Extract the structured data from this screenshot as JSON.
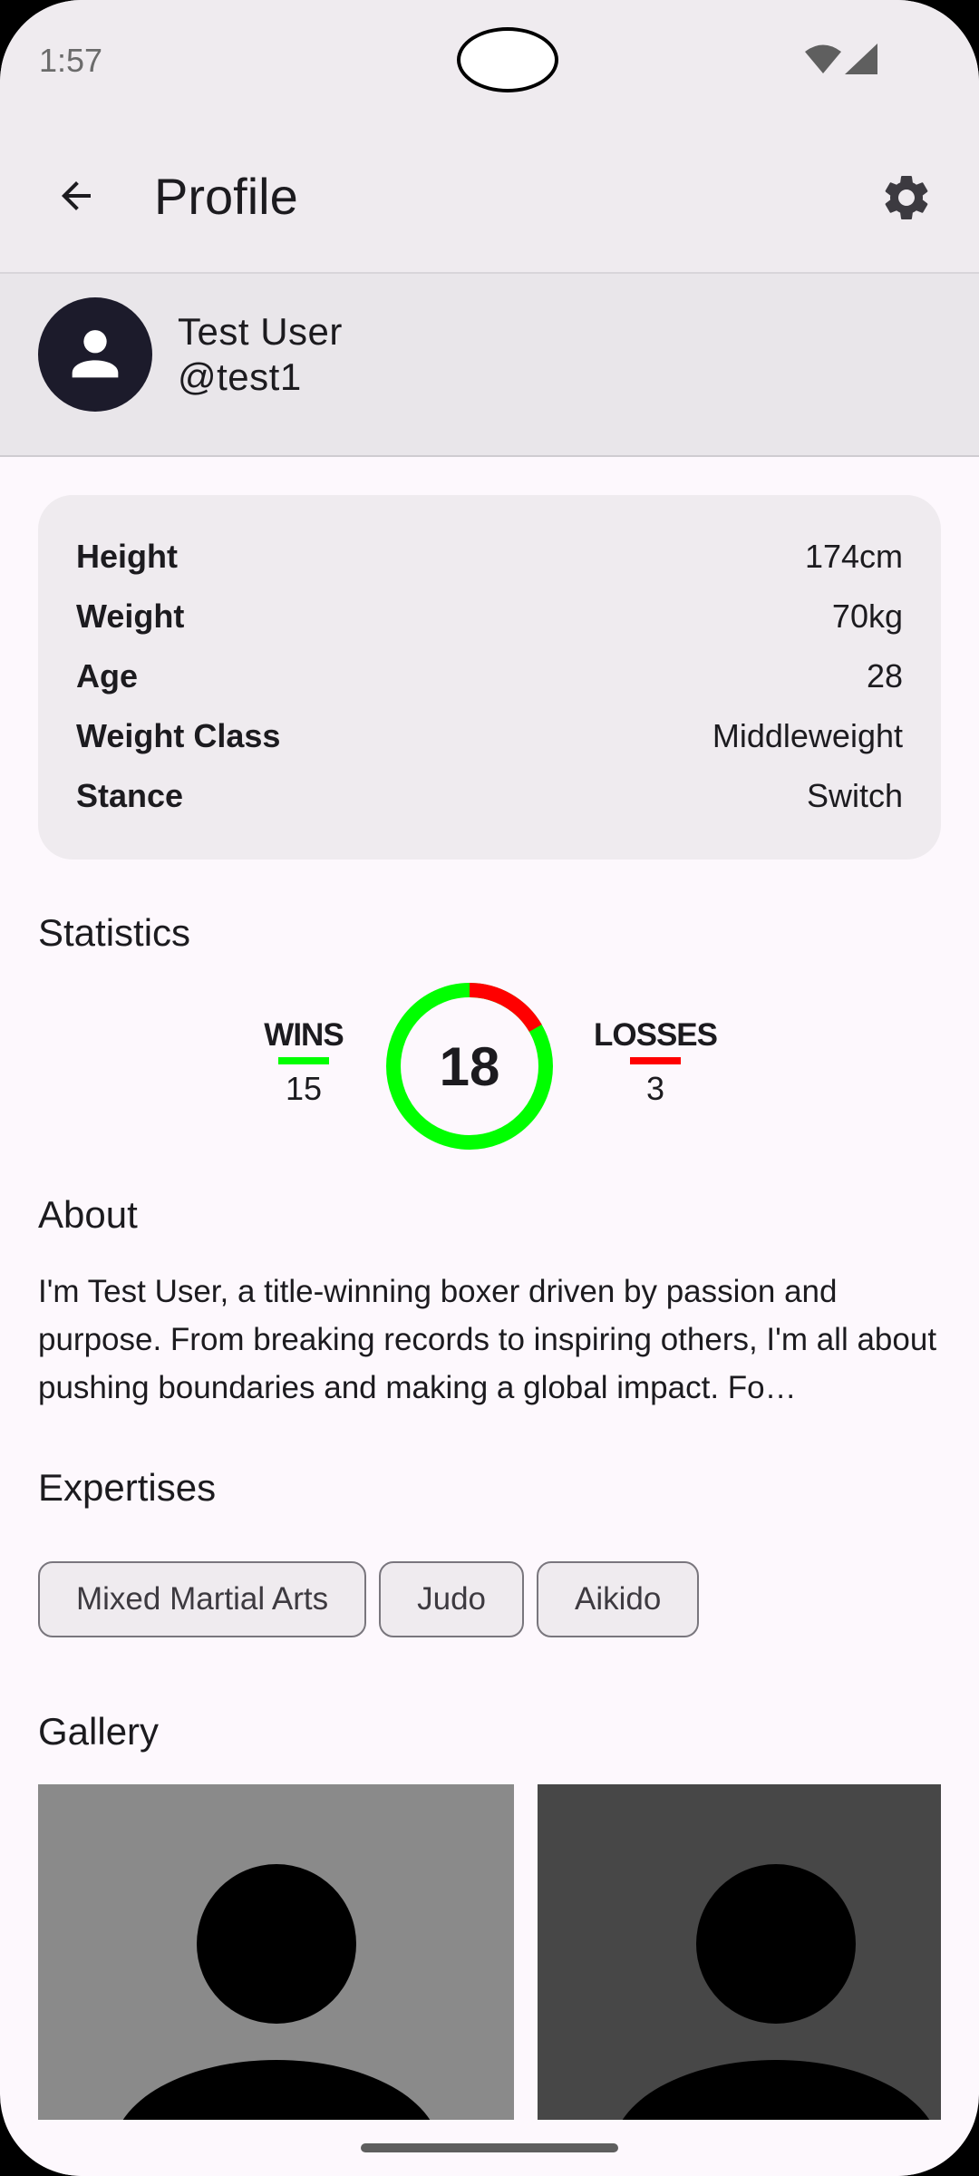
{
  "status_bar": {
    "time": "1:57"
  },
  "app_bar": {
    "title": "Profile"
  },
  "profile": {
    "name": "Test User",
    "handle": "@test1"
  },
  "info": [
    {
      "label": "Height",
      "value": "174cm"
    },
    {
      "label": "Weight",
      "value": "70kg"
    },
    {
      "label": "Age",
      "value": "28"
    },
    {
      "label": "Weight Class",
      "value": "Middleweight"
    },
    {
      "label": "Stance",
      "value": "Switch"
    }
  ],
  "statistics": {
    "title": "Statistics",
    "wins_label": "WINS",
    "wins": 15,
    "losses_label": "LOSSES",
    "losses": 3,
    "total": 18,
    "win_color": "#00ff00",
    "loss_color": "#ff0000"
  },
  "about": {
    "title": "About",
    "text": "I'm Test User, a title-winning boxer driven by passion and purpose. From breaking records to inspiring others, I'm all about pushing boundaries and making a global impact. Fo…"
  },
  "expertises": {
    "title": "Expertises",
    "chips": [
      "Mixed Martial Arts",
      "Judo",
      "Aikido"
    ]
  },
  "gallery": {
    "title": "Gallery"
  },
  "colors": {
    "surface": "#fdf8fd",
    "surface_container": "#efebef",
    "avatar_bg": "#1c1b2b",
    "gallery_1_bg": "#8a8a8a",
    "gallery_2_bg": "#474747"
  }
}
